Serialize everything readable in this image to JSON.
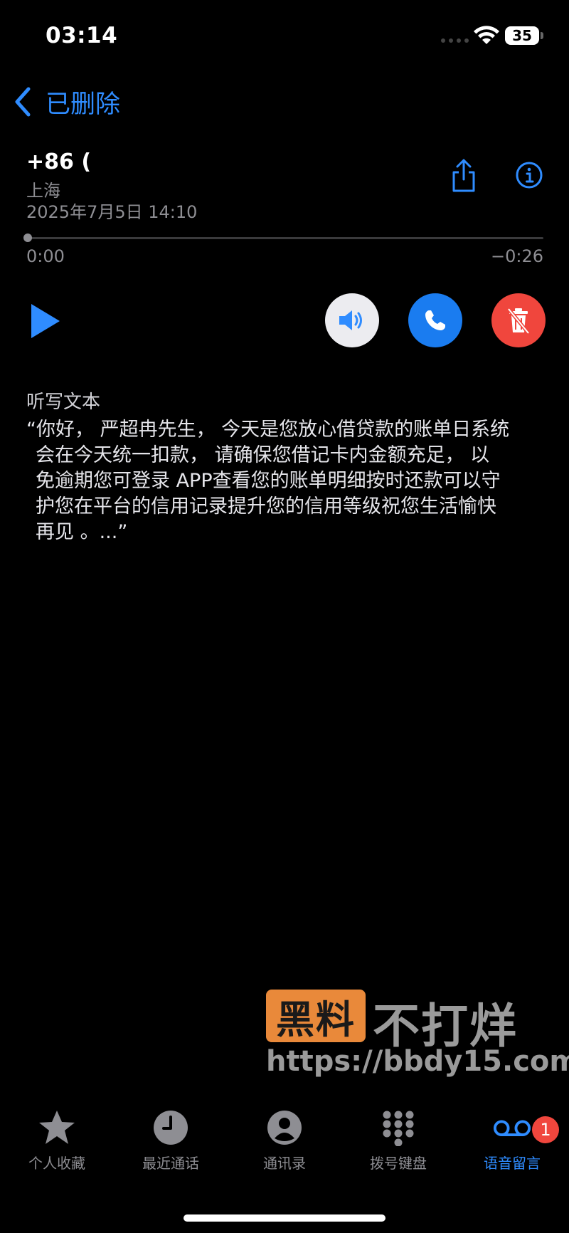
{
  "status_bar": {
    "time": "03:14",
    "battery": "35"
  },
  "nav": {
    "back_label": "已删除"
  },
  "voicemail": {
    "phone": "+86 (",
    "location": "上海",
    "datetime": "2025年7月5日 14:10",
    "progress": 0.0,
    "elapsed": "0:00",
    "remaining": "−0:26"
  },
  "transcript": {
    "title": "听写文本",
    "lines": [
      "“你好， 严超冉先生， 今天是您放心借贷款的账单日系统",
      "会在今天统一扣款， 请确保您借记卡内金额充足， 以",
      "免逾期您可登录 APP查看您的账单明细按时还款可以守",
      "护您在平台的信用记录提升您的信用等级祝您生活愉快",
      "再见 。...”"
    ]
  },
  "watermark": {
    "box": "黑料",
    "text": "不打烊",
    "url": "https://bbdy15.com"
  },
  "tabs": [
    {
      "label": "个人收藏",
      "icon": "star-icon"
    },
    {
      "label": "最近通话",
      "icon": "clock-icon"
    },
    {
      "label": "通讯录",
      "icon": "person-icon"
    },
    {
      "label": "拨号键盘",
      "icon": "keypad-icon"
    },
    {
      "label": "语音留言",
      "icon": "voicemail-icon",
      "active": true,
      "badge": "1"
    }
  ],
  "colors": {
    "accent": "#2f8cff",
    "delete": "#f0463d",
    "call": "#1a7cf0"
  }
}
